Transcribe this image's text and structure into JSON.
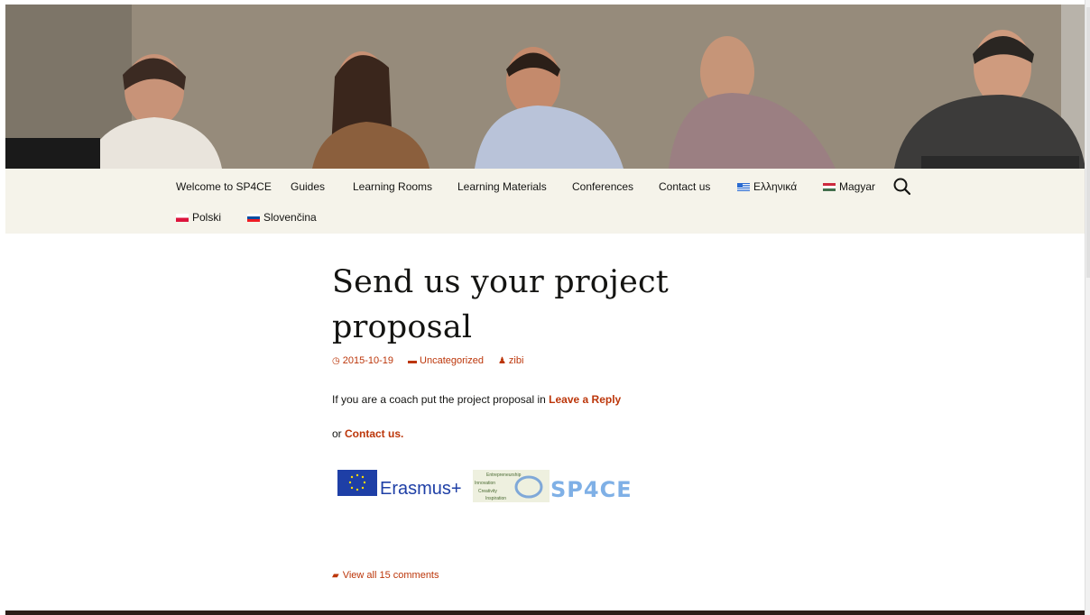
{
  "nav": {
    "row1": [
      {
        "label": "Welcome to SP4CE"
      },
      {
        "label": "Guides"
      },
      {
        "label": "Learning Rooms"
      },
      {
        "label": "Learning Materials"
      },
      {
        "label": "Conferences"
      },
      {
        "label": "Contact us"
      },
      {
        "label": "Ελληνικά",
        "flag": "greece-flag-icon"
      },
      {
        "label": "Magyar",
        "flag": "hungary-flag-icon"
      }
    ],
    "row2": [
      {
        "label": "Polski",
        "flag": "poland-flag-icon"
      },
      {
        "label": "Slovenčina",
        "flag": "slovakia-flag-icon"
      }
    ],
    "search_icon": "search-icon"
  },
  "post": {
    "title_line1": "Send us your project",
    "title_line2": "proposal",
    "date": "2015-10-19",
    "category": "Uncategorized",
    "author": "zibi",
    "body_prefix": "If you are a coach put the project proposal in",
    "leave_reply": "Leave a Reply",
    "or_text": "or",
    "contact_link": "Contact us.",
    "comments_link": "View all 15 comments"
  },
  "logos": {
    "erasmus": "Erasmus+",
    "sp4ce": "SP4CE",
    "tagline_lines": [
      "Entrepreneurship",
      "Innovation",
      "Creativity",
      "Inspiration"
    ]
  },
  "colors": {
    "accent": "#bc360a",
    "nav_bg": "#f5f3ea",
    "text": "#141412",
    "footer": "#2c1d17"
  }
}
